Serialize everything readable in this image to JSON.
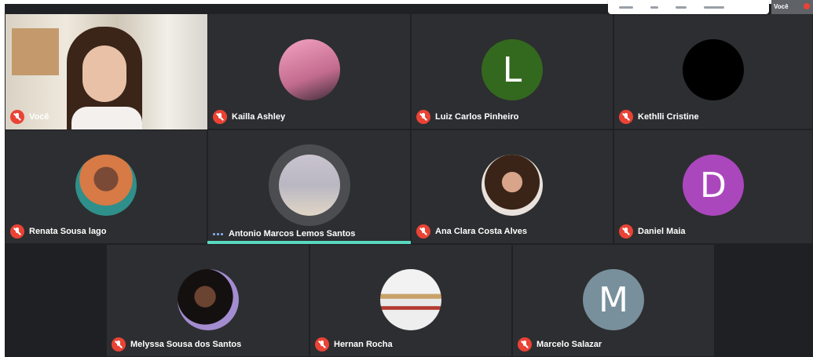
{
  "self_tile": {
    "name": "Você"
  },
  "top_bar": {
    "self_thumb_label": "Você"
  },
  "participants": [
    {
      "name": "Kailla Ashley",
      "avatar_type": "photo",
      "avatar_color": "#c26b8f",
      "muted": true
    },
    {
      "name": "Luiz Carlos Pinheiro",
      "avatar_type": "letter",
      "letter": "L",
      "avatar_color": "#33691e",
      "muted": true
    },
    {
      "name": "Kethlli Cristine",
      "avatar_type": "photo",
      "avatar_color": "#000000",
      "muted": true
    },
    {
      "name": "Renata Sousa lago",
      "avatar_type": "photo",
      "avatar_color": "#d77a45",
      "muted": true
    },
    {
      "name": "Antonio Marcos Lemos Santos",
      "avatar_type": "photo",
      "avatar_color": "#b9b7c2",
      "muted": false,
      "speaking": true
    },
    {
      "name": "Ana Clara Costa Alves",
      "avatar_type": "photo",
      "avatar_color": "#6b4a3c",
      "muted": true
    },
    {
      "name": "Daniel Maia",
      "avatar_type": "letter",
      "letter": "D",
      "avatar_color": "#ab47bc",
      "muted": true
    },
    {
      "name": "Melyssa Sousa dos Santos",
      "avatar_type": "photo",
      "avatar_color": "#a38ccf",
      "muted": true
    },
    {
      "name": "Hernan Rocha",
      "avatar_type": "photo",
      "avatar_color": "#dfe3e6",
      "muted": true
    },
    {
      "name": "Marcelo Salazar",
      "avatar_type": "letter",
      "letter": "M",
      "avatar_color": "#78909c",
      "muted": true
    }
  ],
  "colors": {
    "background": "#202124",
    "tile": "#2d2e31",
    "muted_mic": "#ea4335",
    "active_speaker": "#5bd8c0"
  }
}
